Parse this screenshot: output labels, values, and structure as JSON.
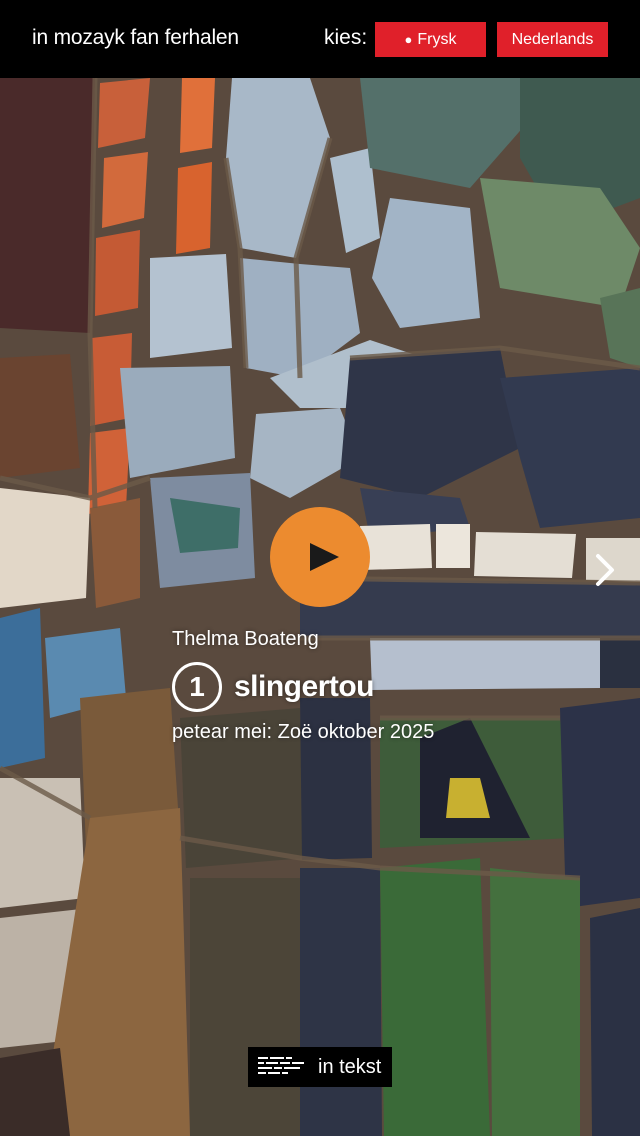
{
  "header": {
    "site_title": "in mozayk fan ferhalen",
    "language_label": "kies:",
    "languages": [
      {
        "label": "Frysk",
        "selected": true
      },
      {
        "label": "Nederlands",
        "selected": false
      }
    ],
    "accent_color": "#e0202a"
  },
  "story": {
    "speaker": "Thelma Boateng",
    "episode_number": "1",
    "episode_title": "slingertou",
    "interview_line": "petear mei: Zoë oktober 2025"
  },
  "controls": {
    "play_icon": "play-icon",
    "next_icon": "chevron-right-icon",
    "play_color": "#ec8b2f",
    "text_button_label": "in tekst",
    "text_button_icon": "text-lines-icon"
  }
}
